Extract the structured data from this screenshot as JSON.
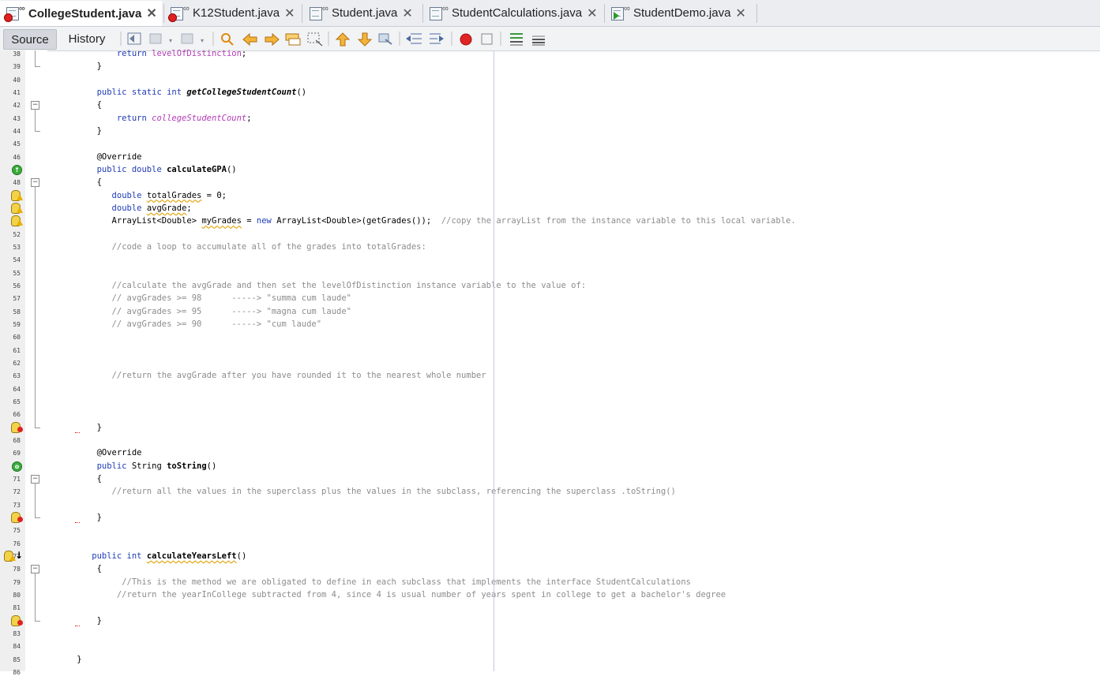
{
  "tabs": [
    {
      "label": "CollegeStudent.java",
      "active": true,
      "icon": "java-file-error-icon"
    },
    {
      "label": "K12Student.java",
      "active": false,
      "icon": "java-file-error-icon"
    },
    {
      "label": "Student.java",
      "active": false,
      "icon": "java-file-icon"
    },
    {
      "label": "StudentCalculations.java",
      "active": false,
      "icon": "java-interface-file-icon"
    },
    {
      "label": "StudentDemo.java",
      "active": false,
      "icon": "java-main-file-icon"
    }
  ],
  "close_glyph": "✕",
  "toolbar": {
    "source_label": "Source",
    "history_label": "History"
  },
  "editor": {
    "lines": [
      {
        "n": "38",
        "text": "            return levelOfDistinction;"
      },
      {
        "n": "39",
        "text": "        }"
      },
      {
        "n": "40",
        "text": ""
      },
      {
        "n": "41",
        "text": "        public static int getCollegeStudentCount()"
      },
      {
        "n": "42",
        "text": "        {"
      },
      {
        "n": "43",
        "text": "            return collegeStudentCount;"
      },
      {
        "n": "44",
        "text": "        }"
      },
      {
        "n": "45",
        "text": ""
      },
      {
        "n": "46",
        "text": "        @Override"
      },
      {
        "n": "47",
        "text": "        public double calculateGPA()"
      },
      {
        "n": "48",
        "text": "        {"
      },
      {
        "n": "49",
        "text": "           double totalGrades = 0;"
      },
      {
        "n": "50",
        "text": "           double avgGrade;"
      },
      {
        "n": "51",
        "text": "           ArrayList<Double> myGrades = new ArrayList<Double>(getGrades());  //copy the arrayList from the instance variable to this local variable."
      },
      {
        "n": "52",
        "text": ""
      },
      {
        "n": "53",
        "text": "           //code a loop to accumulate all of the grades into totalGrades:"
      },
      {
        "n": "54",
        "text": ""
      },
      {
        "n": "55",
        "text": ""
      },
      {
        "n": "56",
        "text": "           //calculate the avgGrade and then set the levelOfDistinction instance variable to the value of:"
      },
      {
        "n": "57",
        "text": "           // avgGrades >= 98      -----> \"summa cum laude\""
      },
      {
        "n": "58",
        "text": "           // avgGrades >= 95      -----> \"magna cum laude\""
      },
      {
        "n": "59",
        "text": "           // avgGrades >= 90      -----> \"cum laude\""
      },
      {
        "n": "60",
        "text": ""
      },
      {
        "n": "61",
        "text": ""
      },
      {
        "n": "62",
        "text": ""
      },
      {
        "n": "63",
        "text": "           //return the avgGrade after you have rounded it to the nearest whole number"
      },
      {
        "n": "64",
        "text": ""
      },
      {
        "n": "65",
        "text": ""
      },
      {
        "n": "66",
        "text": ""
      },
      {
        "n": "67",
        "text": "        }"
      },
      {
        "n": "68",
        "text": ""
      },
      {
        "n": "69",
        "text": "        @Override"
      },
      {
        "n": "70",
        "text": "        public String toString()"
      },
      {
        "n": "71",
        "text": "        {"
      },
      {
        "n": "72",
        "text": "           //return all the values in the superclass plus the values in the subclass, referencing the superclass .toString()"
      },
      {
        "n": "73",
        "text": ""
      },
      {
        "n": "74",
        "text": "        }"
      },
      {
        "n": "75",
        "text": ""
      },
      {
        "n": "76",
        "text": ""
      },
      {
        "n": "77",
        "text": "       public int calculateYearsLeft()"
      },
      {
        "n": "78",
        "text": "        {"
      },
      {
        "n": "79",
        "text": "             //This is the method we are obligated to define in each subclass that implements the interface StudentCalculations"
      },
      {
        "n": "80",
        "text": "            //return the yearInCollege subtracted from 4, since 4 is usual number of years spent in college to get a bachelor's degree"
      },
      {
        "n": "81",
        "text": ""
      },
      {
        "n": "82",
        "text": "        }"
      },
      {
        "n": "83",
        "text": ""
      },
      {
        "n": "84",
        "text": ""
      },
      {
        "n": "85",
        "text": "    }"
      },
      {
        "n": "86",
        "text": ""
      }
    ]
  },
  "colors": {
    "keyword": "#1f3bb5",
    "field": "#b23bb5",
    "comment": "#8c8c8c",
    "active_tab_bg": "#ffffff",
    "tabbar_bg": "#ebedf1"
  }
}
